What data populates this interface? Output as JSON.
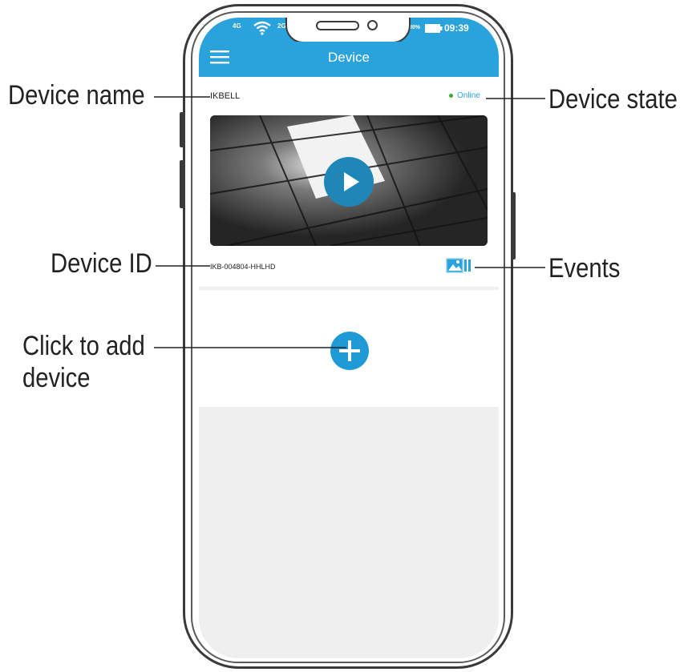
{
  "screen": {
    "title": "Device",
    "status_time": "09:39",
    "status_battery": "89%",
    "status_network_1": "4G",
    "status_network_2": "2G"
  },
  "device": {
    "name": "IKBELL",
    "state": "Online",
    "id": "IKB-004804-HHLHD"
  },
  "callouts": {
    "device_name": "Device name",
    "device_state": "Device state",
    "device_id": "Device ID",
    "events": "Events",
    "add_line1": "Click to add",
    "add_line2": "device"
  },
  "icons": {
    "menu": "hamburger-menu-icon",
    "play": "play-icon",
    "events": "events-gallery-icon",
    "add": "plus-icon",
    "wifi": "wifi-icon",
    "battery": "battery-icon"
  },
  "colors": {
    "accent": "#2aa3dc",
    "online": "#3aa935"
  }
}
